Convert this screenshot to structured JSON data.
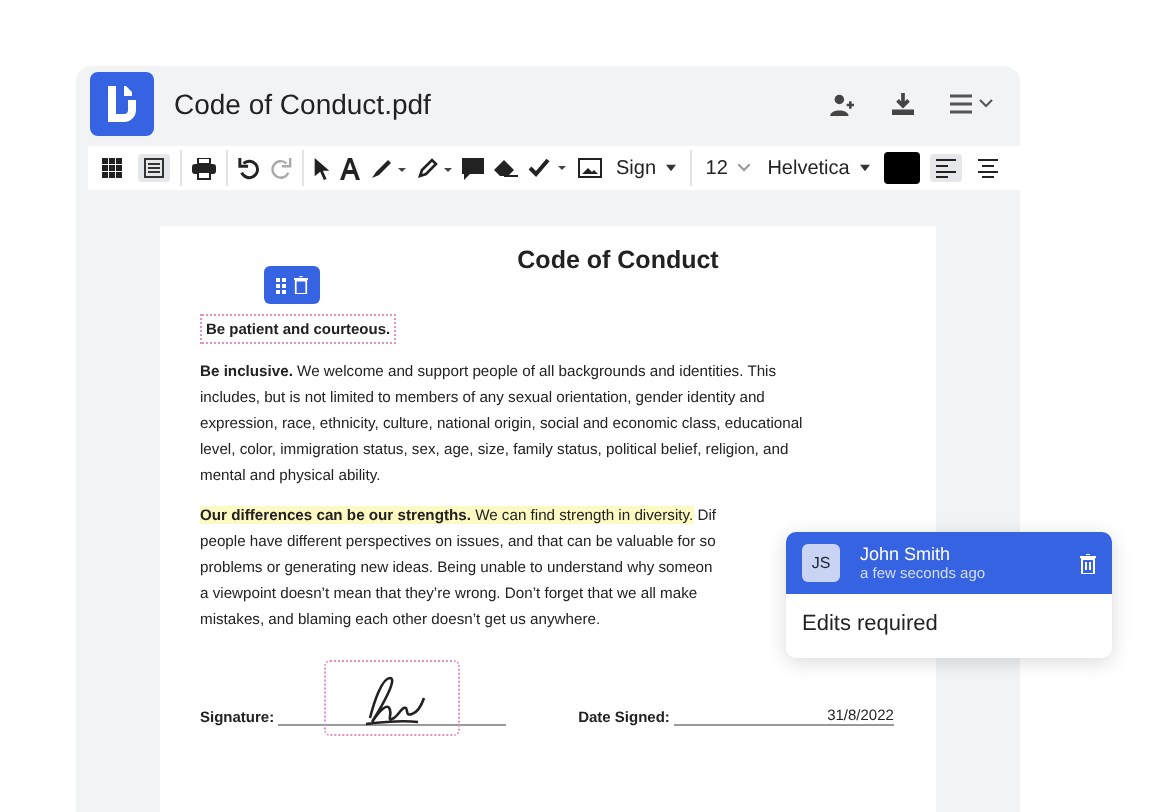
{
  "app": {
    "title": "Code of Conduct.pdf"
  },
  "toolbar": {
    "views": [
      {
        "kind": "grid",
        "selected": false
      },
      {
        "kind": "page",
        "selected": true
      }
    ],
    "sign_label": "Sign",
    "font_size": "12",
    "font_family": "Helvetica",
    "color_swatch": {
      "color": "#000000"
    },
    "align": [
      {
        "kind": "left",
        "selected": true
      },
      {
        "kind": "center",
        "selected": false
      }
    ]
  },
  "document": {
    "title": "Code of Conduct",
    "selected_field": "Be patient and courteous.",
    "paragraph_1": "**Be inclusive.** We welcome and support people of all backgrounds and identities. This includes, but is not limited to members of any sexual orientation, gender identity and expression, race, ethnicity, culture, national origin, social and economic class, educational level, color, immigration status, sex, age, size, family status, political belief, religion, and mental and physical ability.",
    "paragraph_2": [
      [
        {
          "text": "**Our differences can be our strengths.** We can find strength in diversity.",
          "highlighted": true
        },
        {
          "text": " Dif",
          "highlighted": false
        }
      ],
      [
        {
          "text": "people have different perspectives on issues, and that can be valuable for so",
          "highlighted": false
        }
      ],
      [
        {
          "text": "problems or generating new ideas. Being unable to understand why someon",
          "highlighted": false
        }
      ],
      [
        {
          "text": "a viewpoint doesn’t mean that they’re wrong. Don’t forget that we all make",
          "highlighted": false
        }
      ],
      [
        {
          "text": "mistakes, and blaming each other doesn’t get us anywhere.",
          "highlighted": false
        }
      ]
    ],
    "signature_label": "Signature:",
    "date_label": "Date Signed:",
    "date_value": "31/8/2022"
  },
  "comment": {
    "initials": "JS",
    "author": "John Smith",
    "time": "a few seconds ago",
    "text": "Edits required"
  }
}
